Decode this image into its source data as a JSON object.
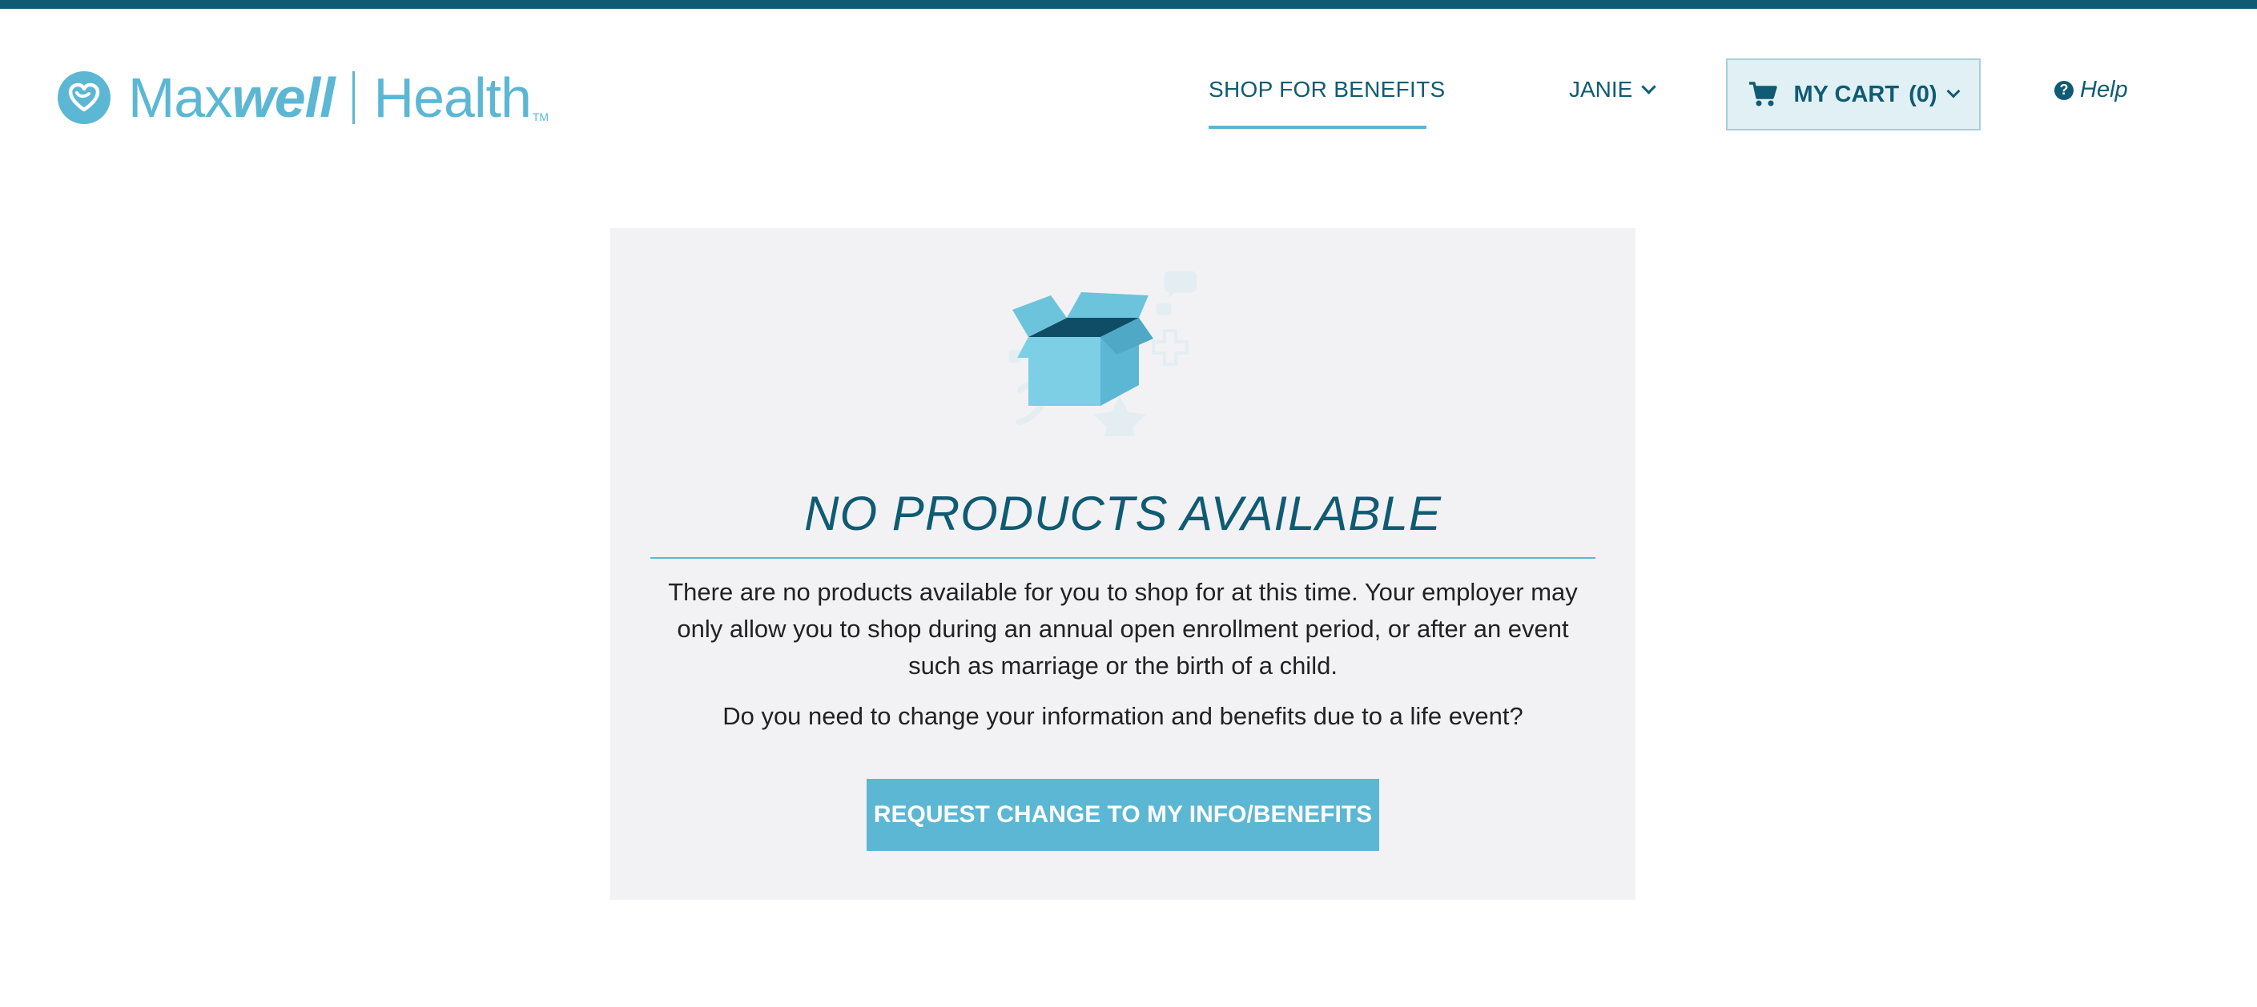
{
  "brand": {
    "name_part1": "Max",
    "name_part2": "well",
    "name_part3": "Health",
    "trademark": "TM"
  },
  "header": {
    "nav_shop": "SHOP FOR BENEFITS",
    "user_name": "JANIE",
    "cart_label": "MY CART",
    "cart_count": "(0)",
    "help_label": "Help"
  },
  "empty_state": {
    "title": "NO PRODUCTS AVAILABLE",
    "message": "There are no products available for you to shop for at this time. Your employer may only allow you to shop during an annual open enrollment period, or after an event such as marriage or the birth of a child.",
    "question": "Do you need to change your information and benefits due to a life event?",
    "button_label": "REQUEST CHANGE TO MY INFO/BENEFITS"
  },
  "colors": {
    "brand_dark": "#0f5b73",
    "brand_light": "#5bb7d3",
    "card_bg": "#f2f2f4"
  },
  "icons": {
    "logo": "heart-logo-icon",
    "cart": "shopping-cart-icon",
    "help": "question-circle-icon",
    "illustration": "open-box-icon"
  }
}
